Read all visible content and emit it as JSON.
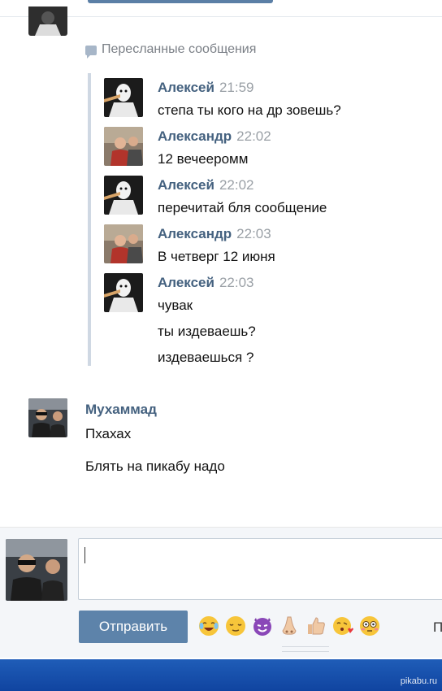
{
  "forwarded": {
    "header": "Пересланные сообщения",
    "messages": [
      {
        "author": "Алексей",
        "time": "21:59",
        "lines": [
          "степа ты кого на др зовешь?"
        ],
        "avatar": "alexey"
      },
      {
        "author": "Александр",
        "time": "22:02",
        "lines": [
          "12 вечееромм"
        ],
        "avatar": "alexander"
      },
      {
        "author": "Алексей",
        "time": "22:02",
        "lines": [
          "перечитай бля сообщение"
        ],
        "avatar": "alexey"
      },
      {
        "author": "Александр",
        "time": "22:03",
        "lines": [
          "В четверг 12 июня"
        ],
        "avatar": "alexander"
      },
      {
        "author": "Алексей",
        "time": "22:03",
        "lines": [
          "чувак",
          "ты издеваешь?",
          "издеваешься ?"
        ],
        "avatar": "alexey"
      }
    ]
  },
  "message": {
    "author": "Мухаммад",
    "lines": [
      "Пхахах",
      "Блять на пикабу надо"
    ]
  },
  "composer": {
    "send_label": "Отправить",
    "cut_letter": "П",
    "emojis": [
      "tears-of-joy",
      "relieved",
      "smiling-imp",
      "nose",
      "thumbs-up",
      "kissing",
      "flushed"
    ]
  },
  "watermark": "pikabu.ru",
  "colors": {
    "author": "#44617f",
    "button": "#5d83aa",
    "taskbar": "#1f5db8"
  }
}
